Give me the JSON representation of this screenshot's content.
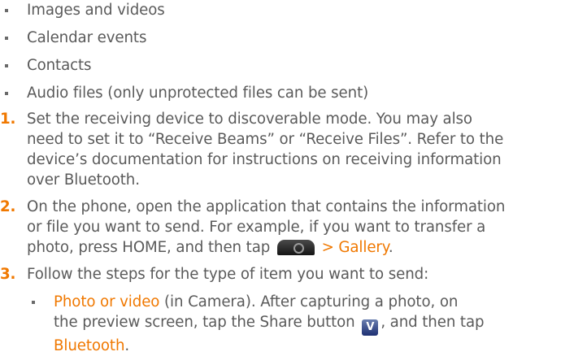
{
  "bullets": [
    "Images and videos",
    "Calendar events",
    "Contacts",
    "Audio files (only unprotected files can be sent)"
  ],
  "steps": [
    {
      "number": "1.",
      "lines": [
        "Set the receiving device to discoverable mode. You may also",
        "need to set it to “Receive Beams” or “Receive Files”. Refer to the",
        "device’s documentation for instructions on receiving information",
        "over Bluetooth."
      ]
    },
    {
      "number": "2.",
      "lines": [
        "On the phone, open the application that contains the information",
        "or file you want to send. For example, if you want to transfer a"
      ],
      "line3_part1": "photo, press HOME, and then tap",
      "line3_part2": "> Gallery",
      "line3_end": "."
    },
    {
      "number": "3.",
      "lines": [
        "Follow the steps for the type of item you want to send:"
      ],
      "sub": {
        "label": "Photo or video",
        "line1_rest": " (in Camera). After capturing a photo, on",
        "line2_part1": "the preview screen, tap the Share button",
        "line2_part2": ", and then tap",
        "line3": "Bluetooth",
        "line3_end": "."
      }
    }
  ],
  "icons": {
    "app_icon": "camera-app-icon",
    "share_icon": "share-icon",
    "share_glyph": "V"
  },
  "colors": {
    "text": "#5a5a5a",
    "accent": "#f07800"
  }
}
